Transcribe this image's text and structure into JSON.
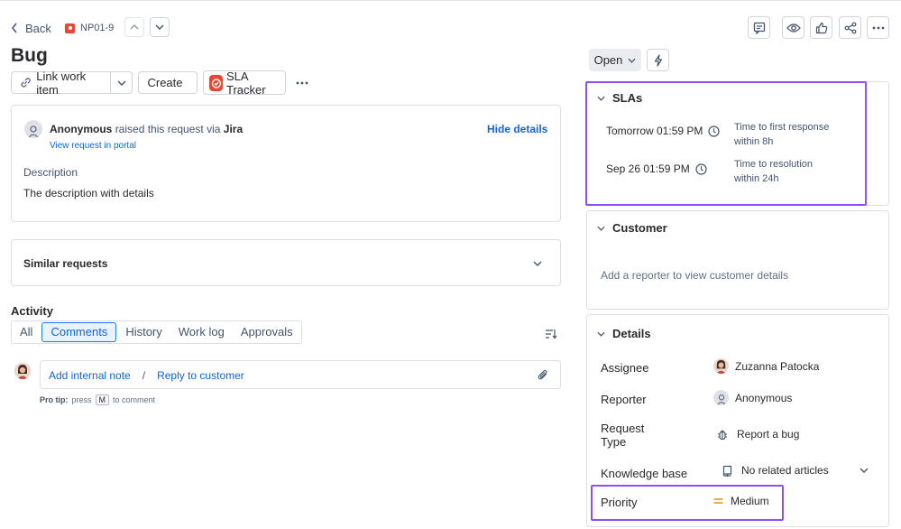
{
  "nav": {
    "back_label": "Back",
    "issue_key": "NP01-9"
  },
  "issue": {
    "type_title": "Bug"
  },
  "toolbar": {
    "link_work_item": "Link work item",
    "create": "Create",
    "sla_tracker": "SLA Tracker"
  },
  "request_card": {
    "requester": "Anonymous",
    "raised_text": "raised this request via",
    "channel": "Jira",
    "view_portal": "View request in portal",
    "hide_details": "Hide details",
    "description_label": "Description",
    "description_text": "The description with details"
  },
  "similar": {
    "label": "Similar requests"
  },
  "activity": {
    "heading": "Activity",
    "tabs": [
      "All",
      "Comments",
      "History",
      "Work log",
      "Approvals"
    ],
    "active_tab": "Comments",
    "add_internal_note": "Add internal note",
    "separator": "/",
    "reply_to_customer": "Reply to customer",
    "pro_tip_label": "Pro tip:",
    "pro_tip_press": "press",
    "pro_tip_key": "M",
    "pro_tip_suffix": "to comment"
  },
  "status": {
    "label": "Open"
  },
  "slas": {
    "heading": "SLAs",
    "items": [
      {
        "time": "Tomorrow 01:59 PM",
        "goal_line1": "Time to first response",
        "goal_line2": "within 8h"
      },
      {
        "time": "Sep 26 01:59 PM",
        "goal_line1": "Time to resolution",
        "goal_line2": "within 24h"
      }
    ]
  },
  "customer": {
    "heading": "Customer",
    "empty_text": "Add a reporter to view customer details"
  },
  "details": {
    "heading": "Details",
    "assignee_label": "Assignee",
    "assignee_value": "Zuzanna Patocka",
    "reporter_label": "Reporter",
    "reporter_value": "Anonymous",
    "request_type_label_line1": "Request",
    "request_type_label_line2": "Type",
    "request_type_value": "Report a bug",
    "knowledge_base_label": "Knowledge base",
    "knowledge_base_value": "No related articles",
    "priority_label": "Priority",
    "priority_value": "Medium"
  },
  "colors": {
    "highlight": "#8f4ff7",
    "link": "#0c66e4",
    "priority_medium": "#e2a03f",
    "sla_icon_bg": "#e34935"
  }
}
